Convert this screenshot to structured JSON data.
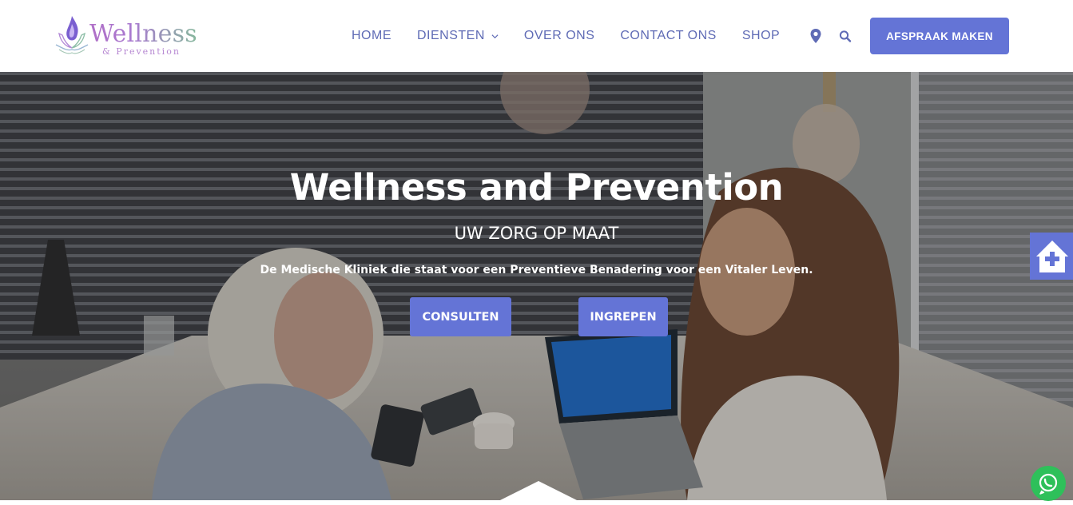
{
  "brand": {
    "name": "Wellness",
    "tagline": "& Prevention",
    "accent_color": "#6474d6"
  },
  "nav": {
    "items": [
      {
        "label": "HOME",
        "has_dropdown": false
      },
      {
        "label": "DIENSTEN",
        "has_dropdown": true
      },
      {
        "label": "OVER ONS",
        "has_dropdown": false
      },
      {
        "label": "CONTACT ONS",
        "has_dropdown": false
      },
      {
        "label": "SHOP",
        "has_dropdown": false
      }
    ],
    "icons": [
      "location-pin-icon",
      "search-icon"
    ],
    "cta_label": "AFSPRAAK MAKEN"
  },
  "hero": {
    "title": "Wellness and Prevention",
    "subtitle": "UW ZORG OP MAAT",
    "tagline": "De Medische Kliniek die staat voor een Preventieve Benadering voor een Vitaler Leven.",
    "buttons": [
      {
        "label": "CONSULTEN"
      },
      {
        "label": "INGREPEN"
      }
    ]
  },
  "floating": {
    "side_tab_icon": "house-medical-icon",
    "chat_icon": "whatsapp-icon",
    "chat_color": "#2ec05a"
  }
}
